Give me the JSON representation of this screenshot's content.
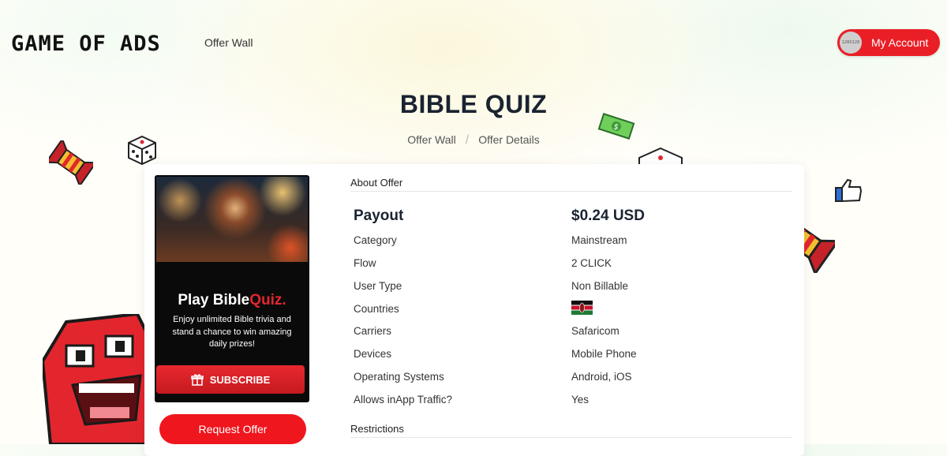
{
  "header": {
    "logo_text": "GAME OF ADS",
    "nav_offer_wall": "Offer Wall",
    "account_label": "My Account",
    "avatar_placeholder": "128X128"
  },
  "page": {
    "title": "BIBLE QUIZ",
    "breadcrumb": [
      "Offer Wall",
      "Offer Details"
    ]
  },
  "creative": {
    "headline_main": "Play Bible",
    "headline_accent": "Quiz.",
    "blurb": "Enjoy unlimited Bible trivia and stand a chance to win amazing daily prizes!",
    "subscribe_label": "SUBSCRIBE"
  },
  "request_offer_label": "Request Offer",
  "about": {
    "heading": "About Offer",
    "payout_label": "Payout",
    "payout_value": "$0.24 USD",
    "rows": [
      {
        "label": "Category",
        "value": "Mainstream"
      },
      {
        "label": "Flow",
        "value": "2 CLICK"
      },
      {
        "label": "User Type",
        "value": "Non Billable"
      },
      {
        "label": "Countries",
        "value": "",
        "flag": "kenya-flag"
      },
      {
        "label": "Carriers",
        "value": "Safaricom"
      },
      {
        "label": "Devices",
        "value": "Mobile Phone"
      },
      {
        "label": "Operating Systems",
        "value": "Android, iOS"
      },
      {
        "label": "Allows inApp Traffic?",
        "value": "Yes"
      }
    ]
  },
  "restrictions_heading": "Restrictions",
  "colors": {
    "brand_red": "#ea1f26",
    "title_dark": "#1a2330"
  }
}
